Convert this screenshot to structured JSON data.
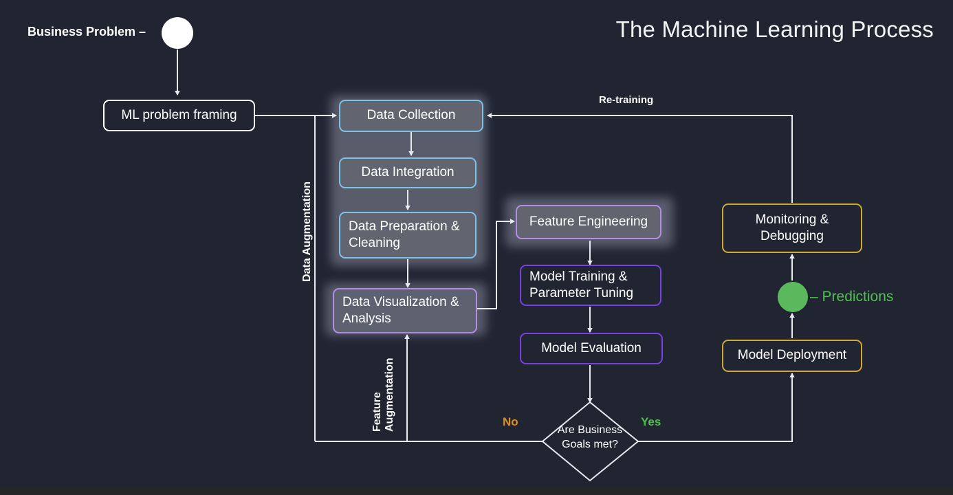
{
  "page": {
    "title": "The Machine Learning Process",
    "background_color": "#212532"
  },
  "colors": {
    "white": "#ffffff",
    "blue_border": "#7cc3ea",
    "purple_border": "#7b3fe4",
    "purple_light_border": "#b58ce8",
    "orange_border": "#d1a832",
    "green": "#4fc04f",
    "orange_text": "#d7902e",
    "group_panel": "#5e6170",
    "box_fill_gray": "#62656f"
  },
  "start": {
    "label": "Business Problem –",
    "dot_name": "business-problem-dot"
  },
  "nodes": {
    "ml_problem_framing": "ML problem framing",
    "data_collection": "Data Collection",
    "data_integration": "Data Integration",
    "data_preparation": "Data Preparation &\nCleaning",
    "data_visualization": "Data Visualization &\nAnalysis",
    "feature_engineering": "Feature Engineering",
    "model_training": "Model Training &\nParameter Tuning",
    "model_evaluation": "Model Evaluation",
    "model_deployment": "Model Deployment",
    "monitoring_debugging": "Monitoring &\nDebugging"
  },
  "decision": {
    "label": "Are Business\nGoals met?",
    "yes_label": "Yes",
    "no_label": "No"
  },
  "edge_labels": {
    "retraining": "Re-training",
    "data_augmentation": "Data Augmentation",
    "feature_augmentation": "Feature\nAugmentation",
    "predictions": "– Predictions"
  }
}
